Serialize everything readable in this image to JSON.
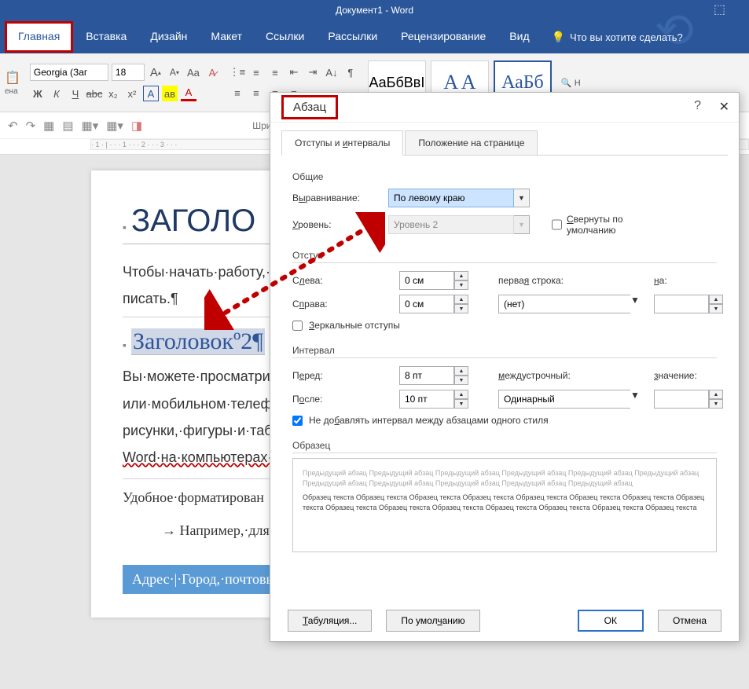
{
  "title": "Документ1 - Word",
  "tabs": {
    "file": "",
    "home": "Главная",
    "insert": "Вставка",
    "design": "Дизайн",
    "layout": "Макет",
    "references": "Ссылки",
    "mailings": "Рассылки",
    "review": "Рецензирование",
    "view": "Вид",
    "tellme": "Что вы хотите сделать?"
  },
  "ribbon": {
    "paste": "ена",
    "font_name": "Georgia (Заг",
    "font_size": "18",
    "btns": {
      "bold": "Ж",
      "italic": "К",
      "underline": "Ч",
      "strike": "abc",
      "sub": "x₂",
      "sup": "x²",
      "textfx": "A",
      "highlight": "aʙ",
      "fontcolor": "A"
    },
    "grow": "A",
    "shrink": "A",
    "case": "Aa",
    "clear": "A",
    "group_font": "Шрифт",
    "styles": {
      "a": "АаБбВвІ",
      "b": "A A",
      "c": "АаБб"
    },
    "find": "Н"
  },
  "qat": {
    "undo": "↶",
    "redo": "↷",
    "new": "▦",
    "open": "▤",
    "save": "💾",
    "table": "▦",
    "eraser": "◧"
  },
  "doc": {
    "h1": "ЗАГОЛО",
    "p1": "Чтобы·начать·работу,·щ\nписать.¶",
    "h2": "Заголовокº2¶",
    "p2a": "Вы·можете·просматрив",
    "p2b": "или·мобильном·телефо",
    "p2c": "рисунки,·фигуры·и·табл",
    "p2d": "Word·на·компьютерах·M",
    "p3": "Удобное·форматирован",
    "p4": "→ Например,·для",
    "addr": "Адрес·|·Город,·почтовы"
  },
  "dialog": {
    "title": "Абзац",
    "tab1": "Отступы и интервалы",
    "tab2": "Положение на странице",
    "s_general": "Общие",
    "l_align": "Выравнивание:",
    "v_align": "По левому краю",
    "l_level": "Уровень:",
    "v_level": "Уровень 2",
    "chk_collapse": "Свернуты по умолчанию",
    "s_indent": "Отступ",
    "l_left": "Слева:",
    "v_left": "0 см",
    "l_right": "Справа:",
    "v_right": "0 см",
    "l_first": "первая строка:",
    "v_first": "(нет)",
    "l_by": "на:",
    "chk_mirror": "Зеркальные отступы",
    "s_spacing": "Интервал",
    "l_before": "Перед:",
    "v_before": "8 пт",
    "l_after": "После:",
    "v_after": "10 пт",
    "l_line": "междустрочный:",
    "v_line": "Одинарный",
    "l_val": "значение:",
    "chk_nospace": "Не добавлять интервал между абзацами одного стиля",
    "s_preview": "Образец",
    "prev_grey": "Предыдущий абзац Предыдущий абзац Предыдущий абзац Предыдущий абзац Предыдущий абзац Предыдущий абзац Предыдущий абзац Предыдущий абзац Предыдущий абзац Предыдущий абзац Предыдущий абзац",
    "prev_sample": "Образец текста Образец текста Образец текста Образец текста Образец текста Образец текста Образец текста Образец текста Образец текста Образец текста Образец текста Образец текста Образец текста Образец текста Образец текста",
    "btn_tabs": "Табуляция...",
    "btn_default": "По умолчанию",
    "btn_ok": "ОК",
    "btn_cancel": "Отмена"
  }
}
